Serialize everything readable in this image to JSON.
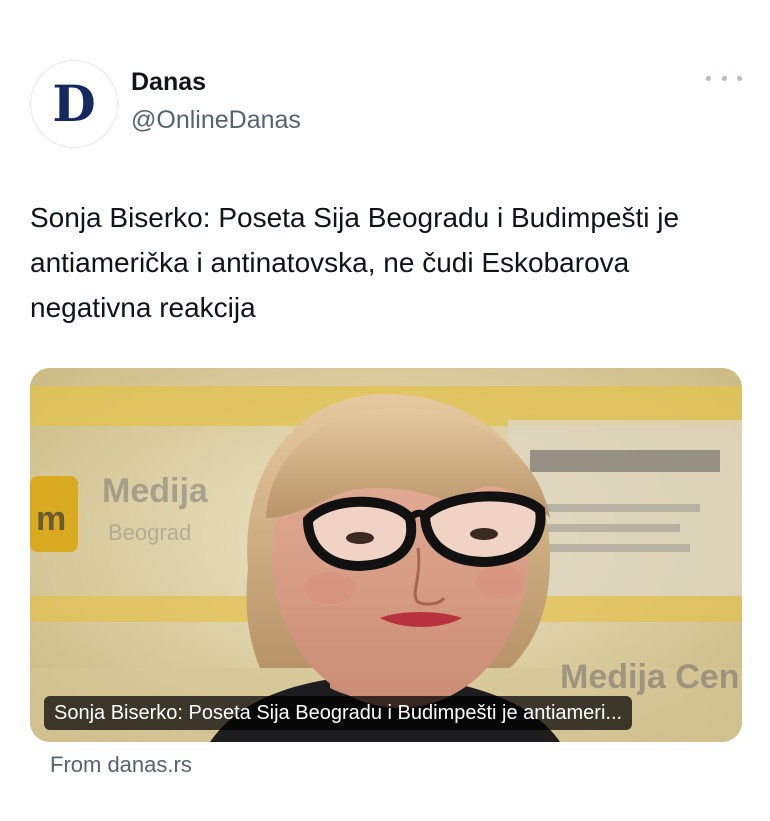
{
  "tweet": {
    "avatar_letter": "D",
    "author_name": "Danas",
    "author_handle": "@OnlineDanas",
    "more_icon": "more-horizontal-icon",
    "text": "Sonja Biserko: Poseta Sija Beogradu i Budimpešti je antiamerička i antinatovska, ne čudi Eskobarova negativna reakcija"
  },
  "card": {
    "caption": "Sonja Biserko: Poseta Sija Beogradu i Budimpešti je antiameri...",
    "source": "From danas.rs",
    "image_signs": {
      "left": "Medija",
      "left_sub": "Beograd",
      "right_bottom": "Medija Cen"
    }
  },
  "colors": {
    "logo_blue": "#14295f",
    "text": "#0f1419",
    "secondary_text": "#536471"
  }
}
